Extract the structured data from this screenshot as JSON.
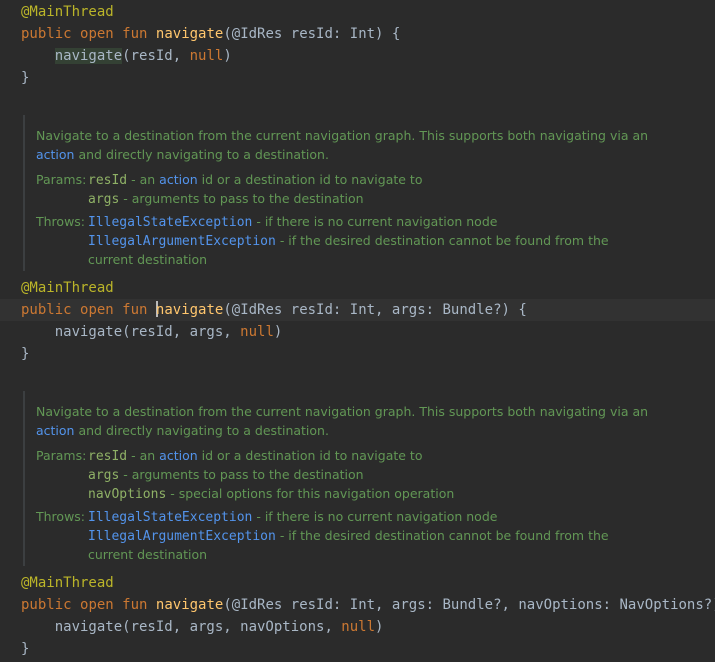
{
  "colors": {
    "background": "#2b2b2b",
    "keyword": "#cc7832",
    "annotation": "#bbb529",
    "function": "#ffc66d",
    "doc_text": "#629755",
    "doc_link": "#5394ec"
  },
  "code": {
    "annotation": "@MainThread",
    "kw_public": "public",
    "kw_open": "open",
    "kw_fun": "fun",
    "fn_name": "navigate",
    "kw_null": "null",
    "close_brace": "}",
    "block1": {
      "params": "(@IdRes resId: Int) {",
      "call_args": "(resId, ",
      "call_end": ")"
    },
    "block2": {
      "params": "(@IdRes resId: Int, args: Bundle?) {",
      "call": "navigate(resId, args, ",
      "call_end": ")"
    },
    "block3": {
      "params": "(@IdRes resId: Int, args: Bundle?, navOptions: NavOptions?) {",
      "call": "navigate(resId, args, navOptions, ",
      "call_end": ")"
    }
  },
  "docs": {
    "intro_line1": "Navigate to a destination from the current navigation graph. This supports both navigating via an",
    "intro_action": "action",
    "intro_line2_rest": " and directly navigating to a destination.",
    "params_label": "Params:",
    "throws_label": "Throws:",
    "p_resId": "resId",
    "p_resId_desc1": " - an ",
    "p_resId_action": "action",
    "p_resId_desc2": " id or a destination id to navigate to",
    "p_args": "args",
    "p_args_desc": " - arguments to pass to the destination",
    "p_navOptions": "navOptions",
    "p_navOptions_desc": " - special options for this navigation operation",
    "t_state": "IllegalStateException",
    "t_state_desc": " - if there is no current navigation node",
    "t_arg": "IllegalArgumentException",
    "t_arg_desc": " - if the desired destination cannot be found from the",
    "t_arg_desc2": "current destination"
  }
}
